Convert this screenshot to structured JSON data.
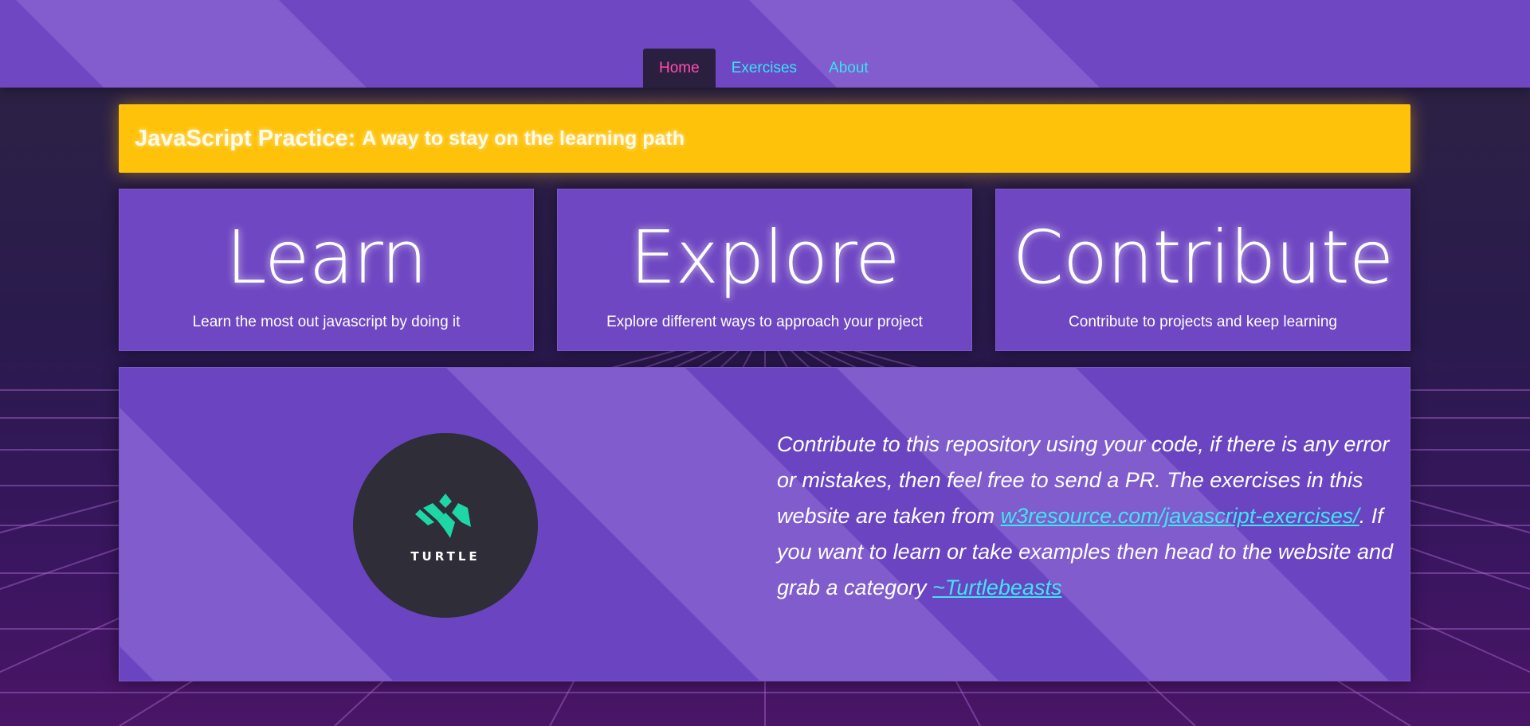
{
  "nav": {
    "items": [
      {
        "label": "Home",
        "active": true
      },
      {
        "label": "Exercises",
        "active": false
      },
      {
        "label": "About",
        "active": false
      }
    ]
  },
  "banner": {
    "title": "JavaScript Practice:",
    "subtitle": "A way to stay on the learning path"
  },
  "cards": [
    {
      "title": "Learn",
      "text": "Learn the most out javascript by doing it"
    },
    {
      "title": "Explore",
      "text": "Explore different ways to approach your project"
    },
    {
      "title": "Contribute",
      "text": "Contribute to projects and keep learning"
    }
  ],
  "about": {
    "logo_text": "TURTLE",
    "text_1": "Contribute to this repository using your code, if there is any error or mistakes, then feel free to send a PR. The exercises in this website are taken from ",
    "link_1": "w3resource.com/javascript-exercises/",
    "text_2": ". If you want to learn or take examples then head to the website and grab a category ",
    "link_2": "~Turtlebeasts"
  },
  "colors": {
    "accent": "#ffc20a",
    "card": "#6f47c2",
    "link": "#3ee6f2",
    "nav_active": "#ff4fb0",
    "logo_mark": "#1ed6a6"
  }
}
